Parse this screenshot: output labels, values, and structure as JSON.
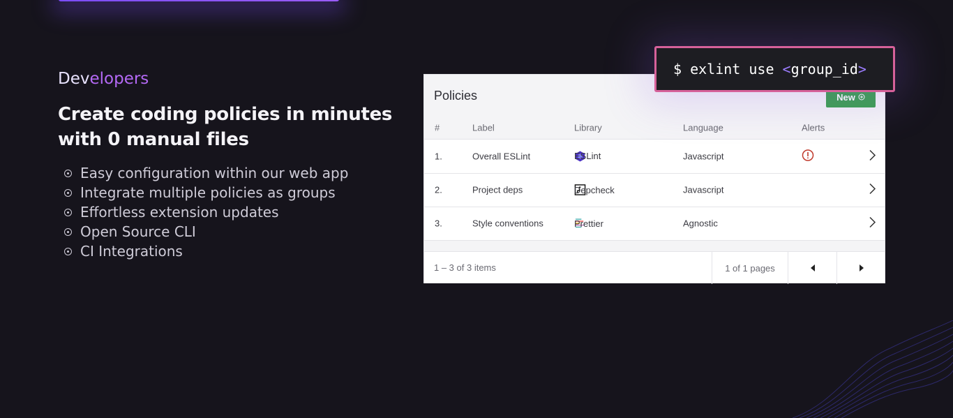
{
  "section": {
    "eyebrow_part1": "Dev",
    "eyebrow_part2": "elopers",
    "headline": "Create coding policies in minutes with 0 manual files",
    "features": [
      "Easy configuration within our web app",
      "Integrate multiple policies as groups",
      "Effortless extension updates",
      "Open Source CLI",
      "CI Integrations"
    ]
  },
  "terminal": {
    "prompt": "$ exlint use ",
    "open": "<",
    "arg": "group_id",
    "close": ">"
  },
  "policies": {
    "title": "Policies",
    "new_label": "New",
    "columns": [
      "#",
      "Label",
      "Library",
      "Language",
      "Alerts"
    ],
    "rows": [
      {
        "num": "1.",
        "label": "Overall ESLint",
        "library": "ESLint",
        "library_icon": "eslint-icon",
        "language": "Javascript",
        "alert": true
      },
      {
        "num": "2.",
        "label": "Project deps",
        "library": "Depcheck",
        "library_icon": "depcheck-icon",
        "language": "Javascript",
        "alert": false
      },
      {
        "num": "3.",
        "label": "Style conventions",
        "library": "Prettier",
        "library_icon": "prettier-icon",
        "language": "Agnostic",
        "alert": false
      }
    ],
    "footer": {
      "count": "1 – 3 of 3 items",
      "pages": "1 of 1 pages"
    }
  },
  "colors": {
    "background": "#16141c",
    "accent_purple": "#b469f5",
    "new_button": "#3aa04d",
    "terminal_border": "#d6619a",
    "alert_red": "#c0392b"
  }
}
